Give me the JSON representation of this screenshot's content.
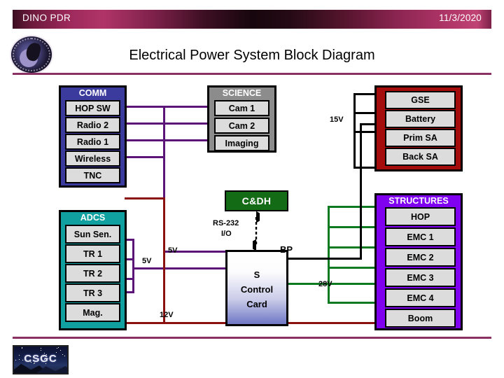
{
  "header": {
    "left_title": "DINO PDR",
    "date": "11/3/2020",
    "slide_title": "Electrical Power System Block Diagram",
    "top_logo_name": "dino-mission-patch-logo",
    "bottom_logo_text": "CSGC"
  },
  "diagram": {
    "groups": [
      {
        "id": "comm",
        "label": "COMM",
        "color": "#3b3b9e",
        "items": [
          "HOP SW",
          "Radio 2",
          "Radio 1",
          "Wireless",
          "TNC"
        ]
      },
      {
        "id": "adcs",
        "label": "ADCS",
        "color": "#11a0a0",
        "items": [
          "Sun Sen.",
          "TR 1",
          "TR 2",
          "TR 3",
          "Mag."
        ]
      },
      {
        "id": "science",
        "label": "SCIENCE",
        "color": "#8c8c8c",
        "items": [
          "Cam 1",
          "Cam 2",
          "Imaging"
        ]
      },
      {
        "id": "gse",
        "label": "",
        "color": "#a50d0d",
        "items": [
          "GSE",
          "Battery",
          "Prim SA",
          "Back SA"
        ]
      },
      {
        "id": "structures",
        "label": "STRUCTURES",
        "color": "#8000f0",
        "items": [
          "HOP",
          "EMC 1",
          "EMC 2",
          "EMC 3",
          "EMC 4",
          "Boom"
        ]
      }
    ],
    "cdh": {
      "label": "C&DH",
      "bus_label_1": "RS-232",
      "bus_label_2": "I/O"
    },
    "control_card": {
      "line1": "S",
      "line2": "Control",
      "line3": "Card",
      "port_label": "BP"
    },
    "voltages": [
      {
        "label": "15V",
        "color": "#000000"
      },
      {
        "label": "5V",
        "color": "#5b1478"
      },
      {
        "label": "5V",
        "color": "#5b1478"
      },
      {
        "label": "28V",
        "color": "#0d7a22"
      },
      {
        "label": "12V",
        "color": "#8b1111"
      }
    ],
    "wire_colors": {
      "data_purple": "#5b1478",
      "power_28v_green": "#0d7a22",
      "power_12v_red": "#8b1111",
      "power_15v_black": "#000000"
    }
  }
}
